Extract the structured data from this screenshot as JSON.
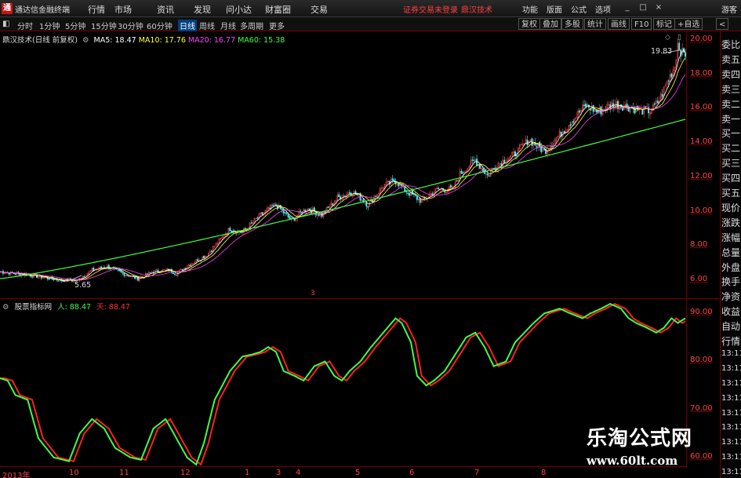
{
  "app": {
    "name": "通达信金融终端",
    "logo": "通"
  },
  "menu": [
    "行情",
    "市场",
    "资讯",
    "发现",
    "问小达",
    "财富圈",
    "交易"
  ],
  "status": {
    "login": "证券交易未登录",
    "formula_name": "鼎汉技术"
  },
  "menu_right": [
    "功能",
    "版面",
    "公式",
    "选项"
  ],
  "guest": "游客",
  "window_controls": [
    "_",
    "□",
    "×"
  ],
  "periods": [
    "分时",
    "1分钟",
    "5分钟",
    "15分钟",
    "30分钟",
    "60分钟",
    "日线",
    "周线",
    "月线",
    "多周期",
    "更多"
  ],
  "active_period": "日线",
  "toolbar_right": [
    "复权",
    "叠加",
    "多股",
    "统计",
    "画线",
    "F10",
    "标记",
    "+自选",
    "<"
  ],
  "main_chart": {
    "title": "鼎汉技术(日线 前复权)",
    "ma": [
      {
        "label": "MA5: 18.47",
        "color": "#ffffff"
      },
      {
        "label": "MA10: 17.76",
        "color": "#ffff40"
      },
      {
        "label": "MA20: 16.77",
        "color": "#ff40ff"
      },
      {
        "label": "MA60: 15.38",
        "color": "#40ff40"
      }
    ],
    "high_label": "19.83",
    "low_label": "5.65",
    "marker": "3",
    "y_ticks": [
      "20.00",
      "18.00",
      "16.00",
      "14.00",
      "12.00",
      "10.00",
      "8.00",
      "6.00"
    ]
  },
  "sub_chart": {
    "title": "股票指标网",
    "ren_label": "人: 88.47",
    "tian_label": "天: 88.47",
    "y_ticks": [
      "90.00",
      "80.00",
      "70.00",
      "60.00"
    ]
  },
  "sidebar": [
    "委比",
    "卖五",
    "卖四",
    "卖三",
    "卖二",
    "卖一",
    "买一",
    "买二",
    "买三",
    "买四",
    "买五",
    "现价",
    "涨跌",
    "涨幅",
    "总量",
    "外盘",
    "换手",
    "净资",
    "收益",
    "自动",
    "行情",
    "13:11",
    "13:11",
    "13:11",
    "13:11",
    "13:11",
    "13:11",
    "13:11",
    "13:11",
    "13:11"
  ],
  "x_labels": [
    "2013年",
    "10",
    "11",
    "12",
    "1",
    "3",
    "4",
    "5",
    "6",
    "7",
    "8"
  ],
  "watermark": {
    "cn": "乐淘公式网",
    "url": "www.60lt.com"
  },
  "colors": {
    "up": "#ff4040",
    "down": "#40ffff",
    "ma5": "#ffffff",
    "ma10": "#ffff40",
    "ma20": "#ff40ff",
    "ma60": "#40ff40",
    "ren": "#40ff40",
    "tian": "#ff2020",
    "axis": "#ff4444"
  },
  "chart_data": {
    "type": "line",
    "main_price": {
      "ylim": [
        5,
        20.5
      ],
      "x_months": [
        "2013年",
        "10",
        "11",
        "12",
        "1",
        "3",
        "4",
        "5",
        "6",
        "7",
        "8"
      ],
      "close_anchor": [
        [
          0,
          6.5
        ],
        [
          20,
          6.3
        ],
        [
          40,
          6.0
        ],
        [
          50,
          6.0
        ],
        [
          60,
          6.6
        ],
        [
          70,
          6.8
        ],
        [
          80,
          6.4
        ],
        [
          90,
          6.1
        ],
        [
          100,
          6.5
        ],
        [
          110,
          6.6
        ],
        [
          115,
          6.4
        ],
        [
          125,
          7.0
        ],
        [
          135,
          7.5
        ],
        [
          150,
          9.0
        ],
        [
          158,
          8.8
        ],
        [
          170,
          9.8
        ],
        [
          180,
          10.4
        ],
        [
          190,
          9.5
        ],
        [
          200,
          10.2
        ],
        [
          210,
          9.8
        ],
        [
          220,
          10.8
        ],
        [
          230,
          11.2
        ],
        [
          240,
          10.4
        ],
        [
          250,
          11.5
        ],
        [
          258,
          11.8
        ],
        [
          265,
          11.2
        ],
        [
          275,
          10.6
        ],
        [
          285,
          11.3
        ],
        [
          295,
          11.3
        ],
        [
          300,
          12.2
        ],
        [
          310,
          13.0
        ],
        [
          318,
          12.1
        ],
        [
          325,
          12.8
        ],
        [
          335,
          13.3
        ],
        [
          345,
          14.2
        ],
        [
          355,
          13.5
        ],
        [
          365,
          14.5
        ],
        [
          375,
          15.5
        ],
        [
          382,
          16.2
        ],
        [
          390,
          15.8
        ],
        [
          400,
          16.3
        ],
        [
          410,
          16.1
        ],
        [
          418,
          15.9
        ],
        [
          425,
          15.9
        ],
        [
          430,
          16.5
        ],
        [
          435,
          17.5
        ],
        [
          440,
          18.5
        ],
        [
          442,
          19.8
        ],
        [
          445,
          19.2
        ]
      ],
      "ma60_start": 6.1,
      "ma60_end": 15.38,
      "high": 19.83,
      "low": 5.65
    },
    "sub_indicator": {
      "ylim": [
        58,
        93
      ],
      "ren_anchor": [
        [
          0,
          76.5
        ],
        [
          5,
          76
        ],
        [
          10,
          73
        ],
        [
          18,
          72
        ],
        [
          25,
          64
        ],
        [
          35,
          60
        ],
        [
          45,
          59.2
        ],
        [
          52,
          65
        ],
        [
          60,
          68
        ],
        [
          68,
          66
        ],
        [
          75,
          62
        ],
        [
          85,
          60
        ],
        [
          92,
          59.5
        ],
        [
          100,
          66
        ],
        [
          108,
          68
        ],
        [
          115,
          64
        ],
        [
          122,
          60
        ],
        [
          128,
          58.5
        ],
        [
          133,
          63
        ],
        [
          140,
          72
        ],
        [
          150,
          78
        ],
        [
          158,
          81
        ],
        [
          165,
          81.5
        ],
        [
          170,
          82
        ],
        [
          175,
          83
        ],
        [
          180,
          82
        ],
        [
          185,
          78
        ],
        [
          192,
          77
        ],
        [
          198,
          76
        ],
        [
          205,
          79
        ],
        [
          212,
          80
        ],
        [
          218,
          77
        ],
        [
          223,
          76
        ],
        [
          228,
          78
        ],
        [
          235,
          80
        ],
        [
          242,
          83
        ],
        [
          250,
          86
        ],
        [
          258,
          89
        ],
        [
          262,
          88
        ],
        [
          268,
          84
        ],
        [
          272,
          77
        ],
        [
          278,
          75
        ],
        [
          283,
          76
        ],
        [
          290,
          78
        ],
        [
          298,
          82
        ],
        [
          304,
          85
        ],
        [
          310,
          86
        ],
        [
          316,
          83
        ],
        [
          322,
          79
        ],
        [
          330,
          80
        ],
        [
          336,
          84
        ],
        [
          342,
          86
        ],
        [
          348,
          88
        ],
        [
          355,
          90
        ],
        [
          365,
          91
        ],
        [
          372,
          90
        ],
        [
          380,
          89
        ],
        [
          385,
          90
        ],
        [
          392,
          91
        ],
        [
          398,
          92
        ],
        [
          405,
          91
        ],
        [
          410,
          89
        ],
        [
          415,
          88
        ],
        [
          422,
          87
        ],
        [
          428,
          86
        ],
        [
          433,
          87
        ],
        [
          438,
          89
        ],
        [
          442,
          88
        ],
        [
          447,
          89
        ]
      ],
      "tian_lag": 3
    }
  }
}
